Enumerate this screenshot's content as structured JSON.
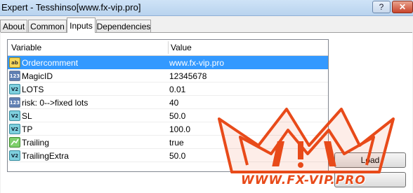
{
  "window": {
    "title": "Expert - Tesshinso[www.fx-vip.pro]",
    "help_symbol": "?",
    "close_symbol": "✕"
  },
  "tabs": [
    {
      "label": "About"
    },
    {
      "label": "Common"
    },
    {
      "label": "Inputs",
      "active": true
    },
    {
      "label": "Dependencies"
    }
  ],
  "grid": {
    "columns": [
      "Variable",
      "Value"
    ],
    "rows": [
      {
        "icon": "ab",
        "variable": "Ordercomment",
        "value": "www.fx-vip.pro",
        "selected": true
      },
      {
        "icon": "123",
        "variable": "MagicID",
        "value": "12345678"
      },
      {
        "icon": "V2",
        "variable": "LOTS",
        "value": "0.01"
      },
      {
        "icon": "123",
        "variable": "risk: 0-->fixed lots",
        "value": "40"
      },
      {
        "icon": "V2",
        "variable": "SL",
        "value": "50.0"
      },
      {
        "icon": "V2",
        "variable": "TP",
        "value": "100.0"
      },
      {
        "icon": "trailing",
        "variable": "Trailing",
        "value": "true"
      },
      {
        "icon": "V2",
        "variable": "TrailingExtra",
        "value": "50.0"
      }
    ]
  },
  "buttons": {
    "load_label": "Load"
  },
  "watermark": {
    "text": "WWW.FX-VIP.PRO",
    "color": "#e84a19"
  },
  "colors": {
    "selection": "#3399ff",
    "titlebar": "#cfe3f7"
  }
}
